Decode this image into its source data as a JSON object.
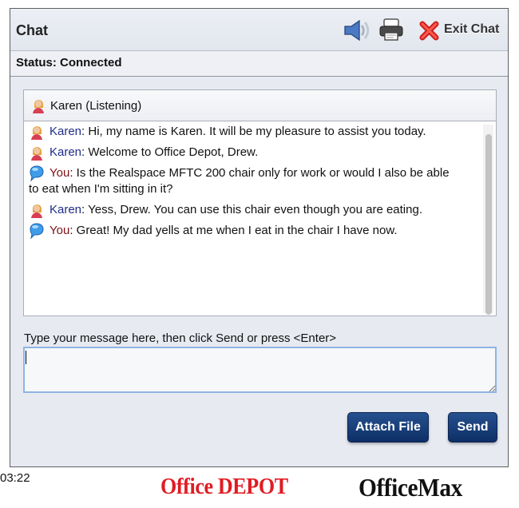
{
  "window": {
    "title": "Chat",
    "exit_label": "Exit Chat",
    "status": "Status: Connected"
  },
  "agent": {
    "header": "Karen (Listening)"
  },
  "transcript": [
    {
      "type": "agent",
      "sender": "Karen",
      "text": ": Hi, my name is Karen. It will be my pleasure to assist you today."
    },
    {
      "type": "agent",
      "sender": "Karen",
      "text": ": Welcome to Office Depot, Drew."
    },
    {
      "type": "user",
      "sender": "You",
      "text": ": Is the Realspace MFTC 200 chair only for work or would I also be able",
      "continuation": "to eat when I'm sitting in it?"
    },
    {
      "type": "agent",
      "sender": "Karen",
      "text": ": Yess, Drew. You can use this chair even though you are eating."
    },
    {
      "type": "user",
      "sender": "You",
      "text": ": Great! My dad yells at me when I eat in the chair I have now."
    }
  ],
  "composer": {
    "prompt": "Type your message here, then click Send or press <Enter>",
    "value": ""
  },
  "buttons": {
    "attach": "Attach File",
    "send": "Send"
  },
  "footer": {
    "timestamp": "03:22",
    "office_depot": "Office DEPOT",
    "office_max": "OfficeMax"
  },
  "colors": {
    "agent_name": "#1f2d8a",
    "user_name": "#7f1116",
    "button": "#173d79",
    "office_depot_red": "#e11b22"
  },
  "icons": [
    "speaker-icon",
    "printer-icon",
    "close-icon",
    "agent-avatar-icon",
    "speech-bubble-icon"
  ]
}
